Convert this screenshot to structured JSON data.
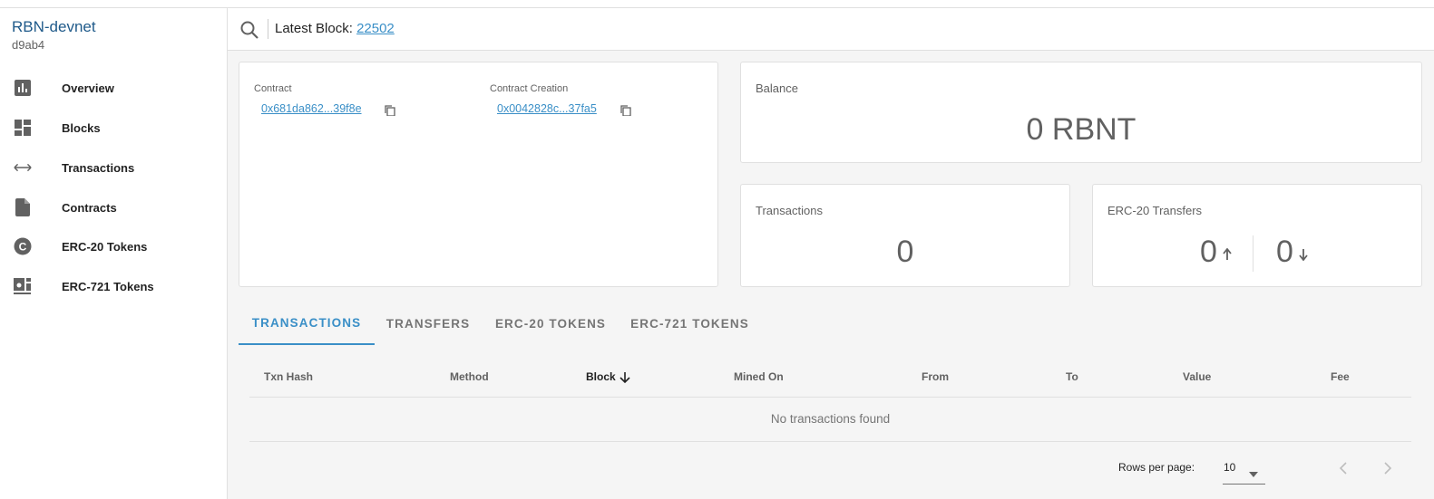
{
  "sidebar": {
    "brand": "RBN-devnet",
    "sub": "d9ab4",
    "items": [
      {
        "label": "Overview",
        "icon": "bar-chart-icon"
      },
      {
        "label": "Blocks",
        "icon": "dashboard-icon"
      },
      {
        "label": "Transactions",
        "icon": "swap-horizontal-icon"
      },
      {
        "label": "Contracts",
        "icon": "document-icon"
      },
      {
        "label": "ERC-20 Tokens",
        "icon": "coin-icon"
      },
      {
        "label": "ERC-721 Tokens",
        "icon": "nft-icon"
      }
    ]
  },
  "header": {
    "latest_label": "Latest Block:",
    "latest_value": "22502"
  },
  "contract_card": {
    "contract_label": "Contract",
    "contract_value": "0x681da862...39f8e",
    "creation_label": "Contract Creation",
    "creation_value": "0x0042828c...37fa5"
  },
  "balance": {
    "label": "Balance",
    "value": "0 RBNT"
  },
  "transactions_stat": {
    "label": "Transactions",
    "value": "0"
  },
  "erc20_stat": {
    "label": "ERC-20 Transfers",
    "in_value": "0",
    "out_value": "0"
  },
  "tabs": [
    "TRANSACTIONS",
    "TRANSFERS",
    "ERC-20 TOKENS",
    "ERC-721 TOKENS"
  ],
  "table": {
    "columns": [
      "Txn Hash",
      "Method",
      "Block",
      "Mined On",
      "From",
      "To",
      "Value",
      "Fee"
    ],
    "empty_text": "No transactions found"
  },
  "pagination": {
    "rows_per_page_label": "Rows per page:",
    "rows_per_page_value": "10"
  },
  "colors": {
    "accent": "#3a8fc7",
    "brand": "#1f5a8a"
  }
}
